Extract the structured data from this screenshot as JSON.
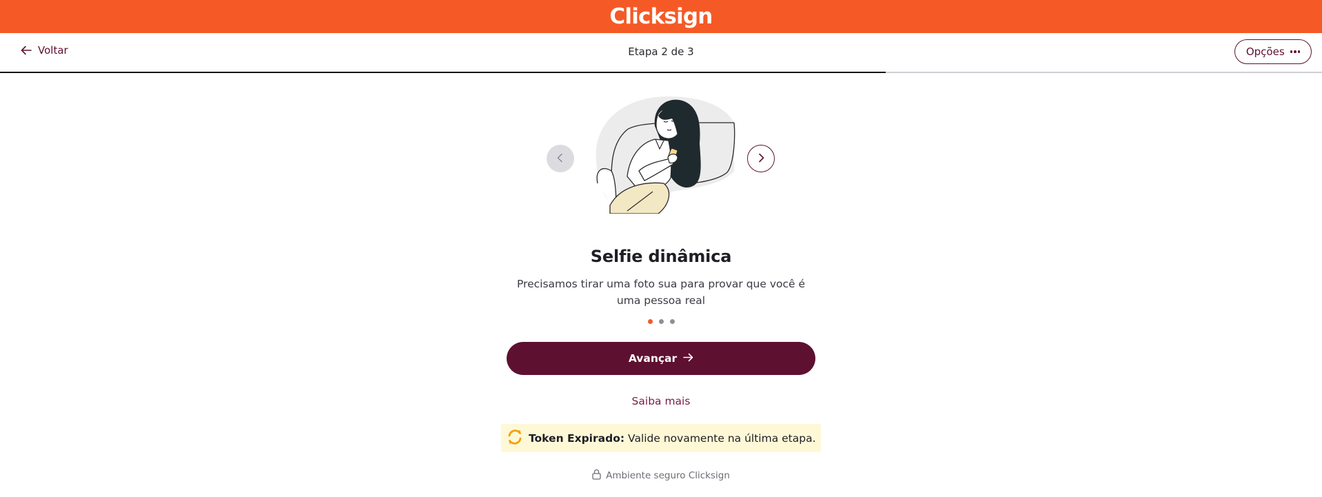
{
  "header": {
    "brand": "Clicksign",
    "brand_color": "#f55a26"
  },
  "nav": {
    "back_label": "Voltar",
    "step_label": "Etapa 2 de 3",
    "options_label": "Opções",
    "progress": 0.67
  },
  "carousel": {
    "prev_icon": "chevron-left-icon",
    "next_icon": "chevron-right-icon",
    "illustration": "woman-with-phone-illustration",
    "active_index": 0,
    "count": 3
  },
  "content": {
    "title": "Selfie dinâmica",
    "description": "Precisamos tirar uma foto sua para provar que você é uma pessoa real",
    "primary_button": "Avançar",
    "learn_more": "Saiba mais"
  },
  "alert": {
    "strong": "Token Expirado:",
    "message": "Valide novamente na última etapa.",
    "icon": "refresh-icon"
  },
  "footer": {
    "secure_label": "Ambiente seguro Clicksign",
    "icon": "lock-icon"
  },
  "colors": {
    "primary": "#5e1030",
    "accent": "#f55a26",
    "alert_bg": "#fff8d7"
  }
}
